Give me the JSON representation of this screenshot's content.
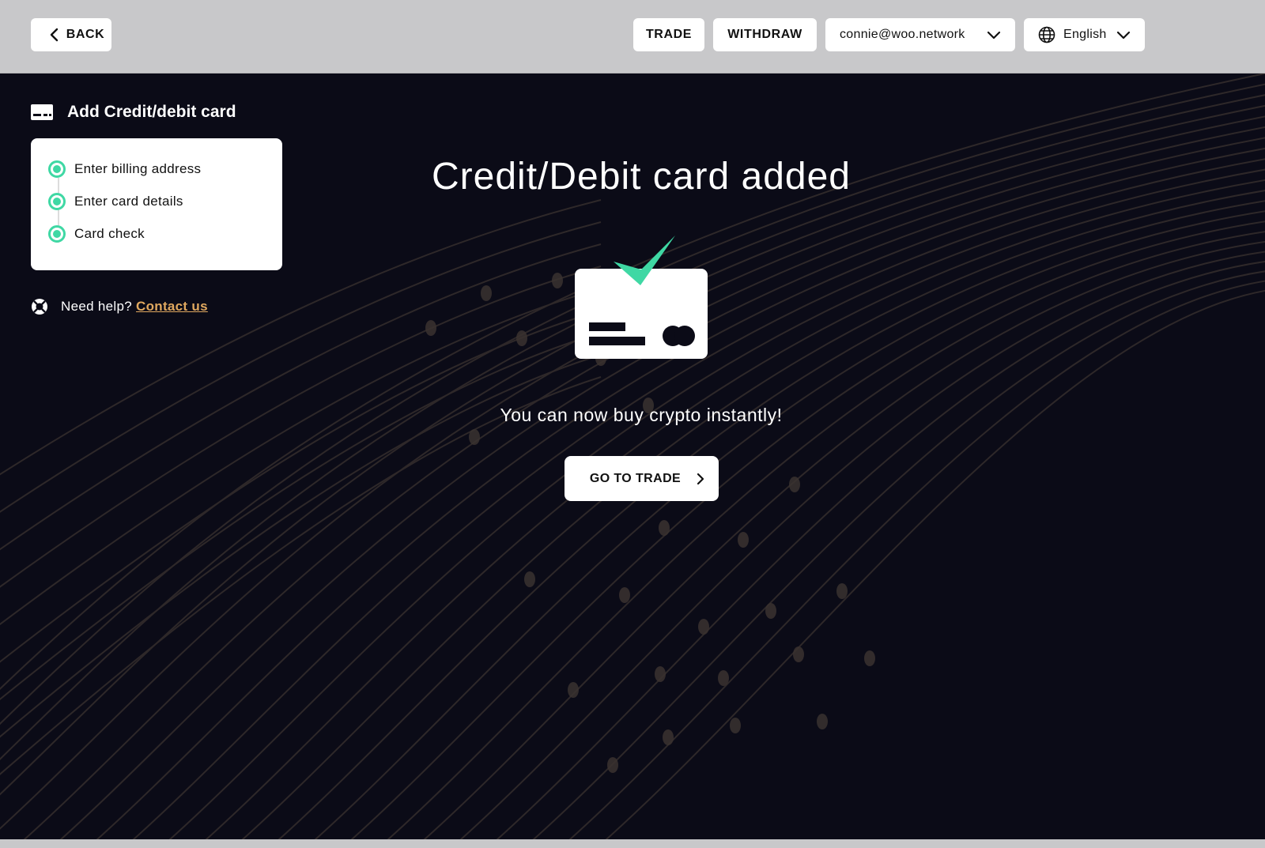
{
  "header": {
    "back_label": "BACK",
    "trade_label": "TRADE",
    "withdraw_label": "WITHDRAW",
    "account_email": "connie@woo.network",
    "language": "English"
  },
  "sidebar": {
    "title": "Add Credit/debit card",
    "steps": [
      {
        "label": "Enter billing address",
        "status": "completed"
      },
      {
        "label": "Enter card details",
        "status": "completed"
      },
      {
        "label": "Card check",
        "status": "completed"
      }
    ],
    "help_text": "Need help?",
    "help_link": "Contact us"
  },
  "main": {
    "title": "Credit/Debit card added",
    "subtitle": "You can now buy crypto instantly!",
    "cta_label": "GO TO TRADE"
  },
  "icons": {
    "back": "chevron-left-icon",
    "account_dropdown": "chevron-down-icon",
    "language": "globe-icon",
    "language_dropdown": "chevron-down-icon",
    "sidebar_title": "credit-card-icon",
    "step_status": "step-complete-icon",
    "help": "lifebuoy-icon",
    "cta": "chevron-right-icon",
    "illustration": "card-added-checkmark-illustration"
  },
  "colors": {
    "background": "#0b0b17",
    "header": "#c8c8ca",
    "accent": "#3fd8a4",
    "link": "#e0a85f",
    "pattern_lines": "#3a3230"
  }
}
